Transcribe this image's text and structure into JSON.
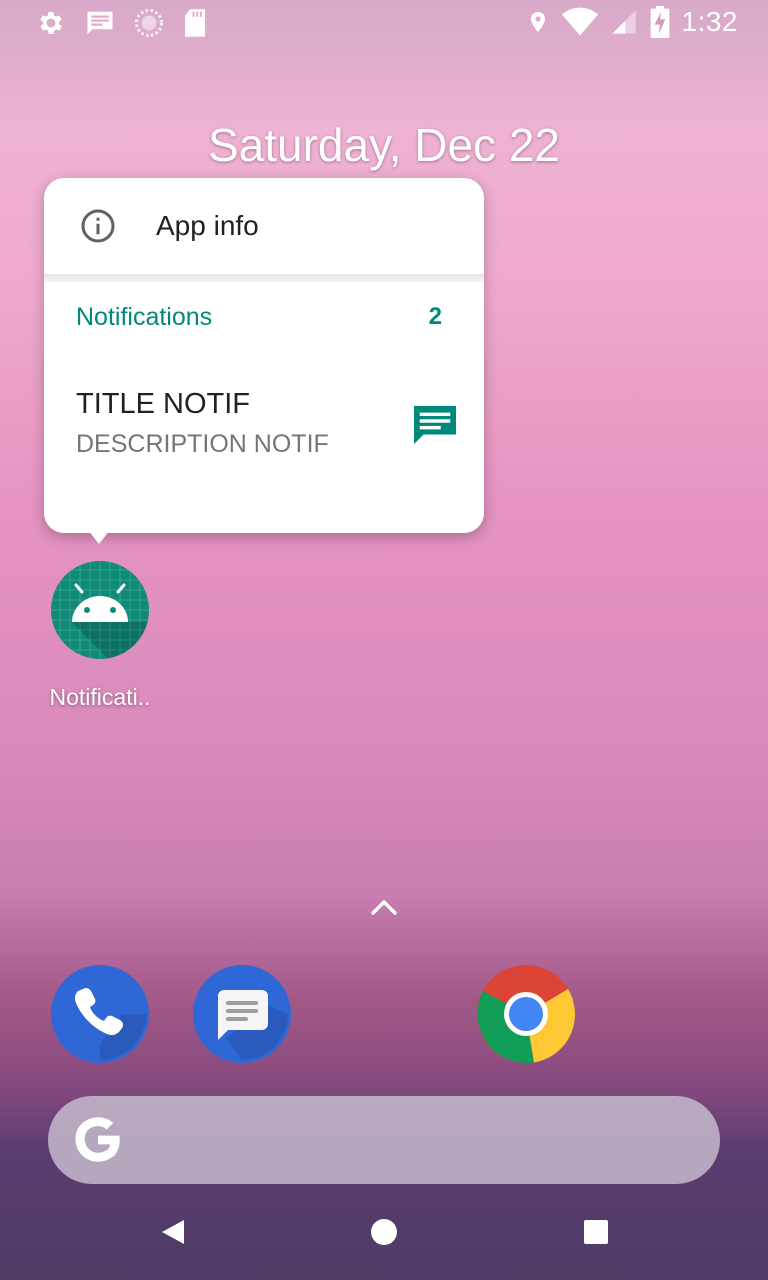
{
  "status_bar": {
    "time": "1:32",
    "left_icons": [
      "gear-icon",
      "message-icon",
      "sync-icon",
      "sd-card-icon"
    ],
    "right_icons": [
      "location-icon",
      "wifi-icon",
      "signal-icon",
      "battery-charging-icon"
    ]
  },
  "home": {
    "date": "Saturday, Dec 22"
  },
  "popup": {
    "app_info_label": "App info",
    "notifications_header": "Notifications",
    "notifications_count": "2",
    "notification": {
      "title": "TITLE NOTIF",
      "description": "DESCRIPTION NOTIF"
    }
  },
  "app": {
    "label": "Notificati..",
    "icon": "android-icon"
  },
  "dock": {
    "apps": [
      "phone-icon",
      "messages-icon",
      "chrome-icon"
    ]
  },
  "search": {
    "logo": "google-g-icon"
  },
  "nav": [
    "back-icon",
    "home-icon",
    "recents-icon"
  ],
  "colors": {
    "accent": "#00897b",
    "popup_bg": "#ffffff"
  }
}
